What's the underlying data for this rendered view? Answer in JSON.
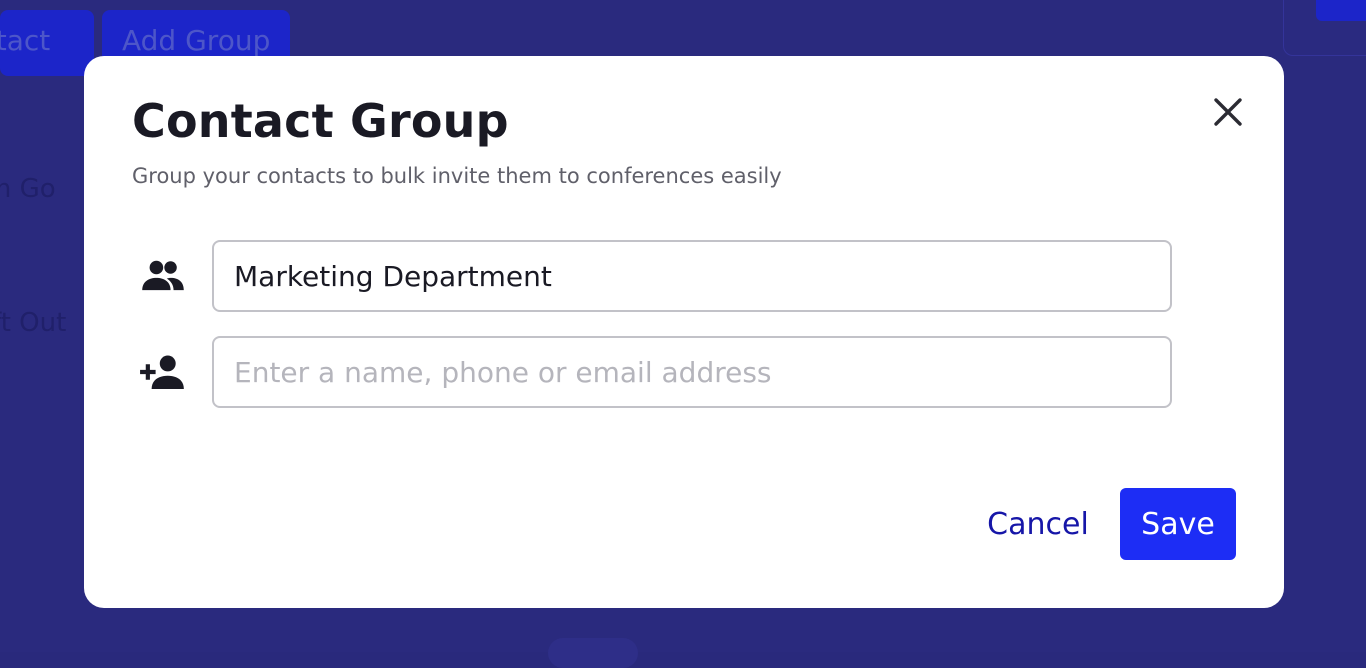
{
  "background": {
    "contact_button_label": "ntact",
    "add_group_button_label": "Add Group",
    "text_1": "rom Go",
    "text_2": "ft Out"
  },
  "modal": {
    "title": "Contact Group",
    "subtitle": "Group your contacts to bulk invite them to conferences easily",
    "group_name": {
      "value": "Marketing Department",
      "icon": "group-icon"
    },
    "add_member": {
      "value": "",
      "placeholder": "Enter a name, phone or email address",
      "icon": "person-add-icon"
    },
    "close_icon": "close-icon",
    "cancel_label": "Cancel",
    "save_label": "Save"
  },
  "colors": {
    "overlay": "#29297c",
    "accent": "#1d2df5",
    "link": "#1616a8",
    "title_text": "#1a1a24",
    "subtitle_text": "#60606a"
  }
}
